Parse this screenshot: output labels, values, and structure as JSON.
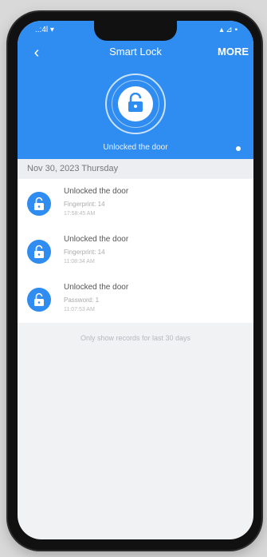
{
  "status": {
    "left": "..:4l ▾",
    "right": "▴ ⊿ ▪"
  },
  "nav": {
    "back_icon": "chevron-left-icon",
    "title": "Smart Lock",
    "more_label": "MORE"
  },
  "hero": {
    "icon": "unlock-icon",
    "status_text": "Unlocked the door"
  },
  "date_label": "Nov 30, 2023 Thursday",
  "records": [
    {
      "title": "Unlocked the door",
      "detail": "Fingerprint: 14",
      "time": "17:58:45 AM",
      "icon": "unlock-icon"
    },
    {
      "title": "Unlocked the door",
      "detail": "Fingerprint: 14",
      "time": "11:08:34 AM",
      "icon": "unlock-icon"
    },
    {
      "title": "Unlocked the door",
      "detail": "Password: 1",
      "time": "11:07:53 AM",
      "icon": "unlock-icon"
    }
  ],
  "footer_note": "Only show records for last 30 days",
  "colors": {
    "accent": "#2f8cf0",
    "background": "#f1f2f4"
  }
}
